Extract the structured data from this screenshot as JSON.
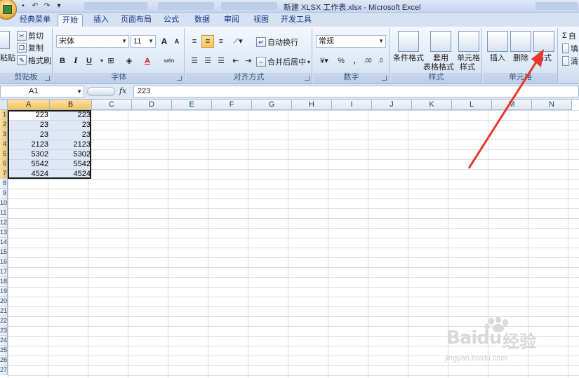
{
  "window": {
    "title": "新建 XLSX 工作表.xlsx - Microsoft Excel"
  },
  "tabs": [
    {
      "label": "经典菜单",
      "active": false
    },
    {
      "label": "开始",
      "active": true
    },
    {
      "label": "插入",
      "active": false
    },
    {
      "label": "页面布局",
      "active": false
    },
    {
      "label": "公式",
      "active": false
    },
    {
      "label": "数据",
      "active": false
    },
    {
      "label": "审阅",
      "active": false
    },
    {
      "label": "视图",
      "active": false
    },
    {
      "label": "开发工具",
      "active": false
    }
  ],
  "ribbon": {
    "clipboard": {
      "label": "剪贴板",
      "paste": "粘贴",
      "cut": "剪切",
      "copy": "复制",
      "format_painter": "格式刷"
    },
    "font": {
      "label": "字体",
      "font_name": "宋体",
      "font_size": "11",
      "bold": "B",
      "italic": "I",
      "underline": "U",
      "grow": "A",
      "shrink": "A",
      "font_color": "A",
      "phonetic": "wén"
    },
    "alignment": {
      "label": "对齐方式",
      "wrap_text": "自动换行",
      "merge_center": "合并后居中"
    },
    "number": {
      "label": "数字",
      "format": "常规",
      "percent": "%",
      "comma": ",",
      "inc_decimal": ".00",
      "dec_decimal": ".0"
    },
    "styles": {
      "label": "样式",
      "conditional": "条件格式",
      "table_line1": "套用",
      "table_line2": "表格格式",
      "cell_styles_line1": "单元格",
      "cell_styles_line2": "样式"
    },
    "cells": {
      "label": "单元格",
      "insert": "插入",
      "delete": "删除",
      "format": "格式"
    },
    "editing": {
      "sum": "Σ",
      "fill": "填",
      "clear": "清",
      "autosum_partial": "自"
    }
  },
  "formula_bar": {
    "name_box": "A1",
    "fx": "fx",
    "value": "223"
  },
  "columns": [
    "A",
    "B",
    "C",
    "D",
    "E",
    "F",
    "G",
    "H",
    "I",
    "J",
    "K",
    "L",
    "M",
    "N"
  ],
  "rows": [
    "1",
    "2",
    "3",
    "4",
    "5",
    "6",
    "7",
    "8",
    "9",
    "10",
    "11",
    "12",
    "13",
    "14",
    "15",
    "16",
    "17",
    "18",
    "19",
    "20",
    "21",
    "22",
    "23",
    "24",
    "25",
    "26",
    "27"
  ],
  "cells": {
    "A": [
      "223",
      "23",
      "23",
      "2123",
      "5302",
      "5542",
      "4524"
    ],
    "B": [
      "223",
      "23",
      "23",
      "2123",
      "5302",
      "5542",
      "4524"
    ]
  },
  "watermark": {
    "brand": "Baidu",
    "brand_cn": "经验",
    "url": "jingyan.baidu.com"
  },
  "colors": {
    "arrow": "#e8362a",
    "selection_header": "#f3c25f"
  }
}
